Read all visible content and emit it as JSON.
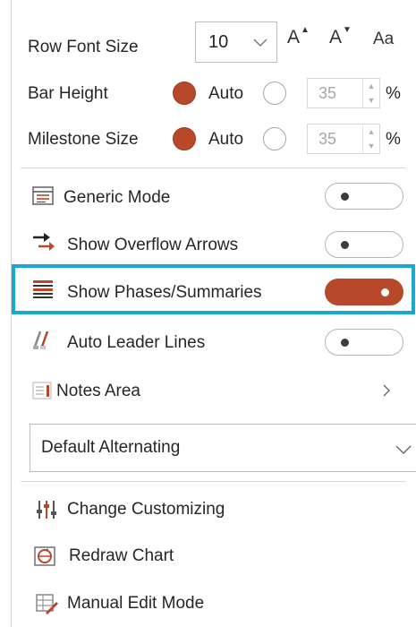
{
  "row_font_size": {
    "label": "Row Font Size",
    "value": "10",
    "increase_icon": "A",
    "decrease_icon": "A",
    "case_icon": "Aa"
  },
  "bar_height": {
    "label": "Bar Height",
    "auto_label": "Auto",
    "auto_selected": true,
    "value": "35",
    "unit": "%"
  },
  "milestone_size": {
    "label": "Milestone Size",
    "auto_label": "Auto",
    "auto_selected": true,
    "value": "35",
    "unit": "%"
  },
  "toggles": [
    {
      "label": "Generic Mode",
      "icon": "generic-mode-icon",
      "on": false
    },
    {
      "label": "Show Overflow Arrows",
      "icon": "overflow-arrows-icon",
      "on": false
    },
    {
      "label": "Show Phases/Summaries",
      "icon": "phases-summaries-icon",
      "on": true
    },
    {
      "label": "Auto Leader Lines",
      "icon": "leader-lines-icon",
      "on": false
    }
  ],
  "notes_area": {
    "label": "Notes Area",
    "icon": "notes-area-icon"
  },
  "row_style": {
    "selected": "Default Alternating"
  },
  "actions": [
    {
      "label": "Change Customizing",
      "icon": "customize-icon"
    },
    {
      "label": "Redraw Chart",
      "icon": "redraw-icon"
    },
    {
      "label": "Manual Edit Mode",
      "icon": "manual-edit-icon"
    }
  ],
  "colors": {
    "accent": "#b74829",
    "highlight": "#18a9d3"
  }
}
